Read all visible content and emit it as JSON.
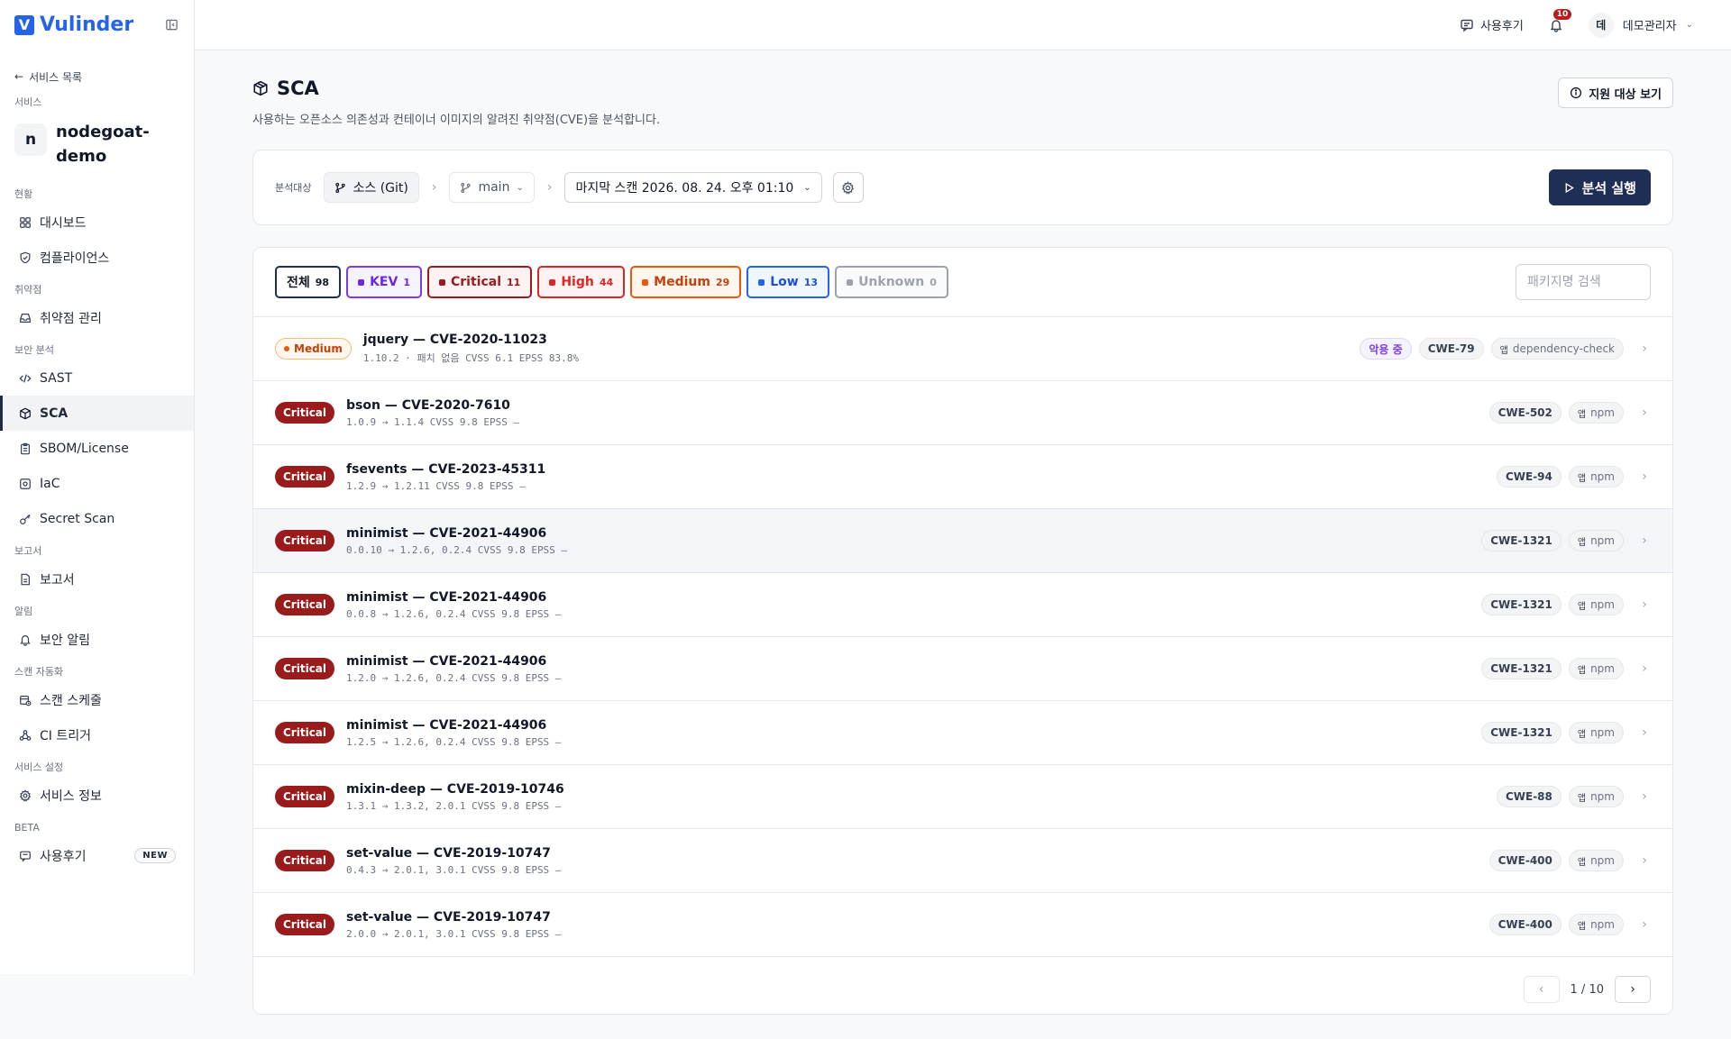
{
  "app": {
    "name": "Vulinder",
    "logo_letter": "V"
  },
  "sidebar": {
    "back_label": "서비스 목록",
    "service_section": "서비스",
    "service_letter": "n",
    "service_name": "nodegoat-demo",
    "groups": [
      {
        "label": "현황",
        "items": [
          {
            "label": "대시보드",
            "icon": "dashboard-icon"
          },
          {
            "label": "컴플라이언스",
            "icon": "shield-icon"
          }
        ]
      },
      {
        "label": "취약점",
        "items": [
          {
            "label": "취약점 관리",
            "icon": "inbox-icon"
          }
        ]
      },
      {
        "label": "보안 분석",
        "items": [
          {
            "label": "SAST",
            "icon": "code-icon"
          },
          {
            "label": "SCA",
            "icon": "package-icon",
            "active": true
          },
          {
            "label": "SBOM/License",
            "icon": "clipboard-icon"
          },
          {
            "label": "IaC",
            "icon": "iac-icon"
          },
          {
            "label": "Secret Scan",
            "icon": "key-icon"
          }
        ]
      },
      {
        "label": "보고서",
        "items": [
          {
            "label": "보고서",
            "icon": "report-icon"
          }
        ]
      },
      {
        "label": "알림",
        "items": [
          {
            "label": "보안 알림",
            "icon": "bell-icon"
          }
        ]
      },
      {
        "label": "스캔 자동화",
        "items": [
          {
            "label": "스캔 스케줄",
            "icon": "calendar-clock-icon"
          },
          {
            "label": "CI 트리거",
            "icon": "webhook-icon"
          }
        ]
      },
      {
        "label": "서비스 설정",
        "items": [
          {
            "label": "서비스 정보",
            "icon": "gear-icon"
          }
        ]
      },
      {
        "label": "BETA",
        "items": [
          {
            "label": "사용후기",
            "icon": "feedback-icon",
            "badge": "NEW"
          }
        ]
      }
    ]
  },
  "header": {
    "feedback_label": "사용후기",
    "notification_count": "10",
    "user_initial": "데",
    "user_name": "데모관리자"
  },
  "page": {
    "title": "SCA",
    "subtitle": "사용하는 오픈소스 의존성과 컨테이너 이미지의 알려진 취약점(CVE)을 분석합니다.",
    "support_button": "지원 대상 보기"
  },
  "target": {
    "label": "분석대상",
    "source": "소스 (Git)",
    "branch": "main",
    "scan": "마지막 스캔 2026. 08. 24. 오후 01:10",
    "run_button": "분석 실행"
  },
  "filters": [
    {
      "label": "전체",
      "count": "98",
      "cls": "f-all",
      "dot": false
    },
    {
      "label": "KEV",
      "count": "1",
      "cls": "f-kev",
      "dot": true
    },
    {
      "label": "Critical",
      "count": "11",
      "cls": "f-crit",
      "dot": true
    },
    {
      "label": "High",
      "count": "44",
      "cls": "f-high",
      "dot": true
    },
    {
      "label": "Medium",
      "count": "29",
      "cls": "f-med",
      "dot": true
    },
    {
      "label": "Low",
      "count": "13",
      "cls": "f-low",
      "dot": true
    },
    {
      "label": "Unknown",
      "count": "0",
      "cls": "f-unk",
      "dot": true
    }
  ],
  "search": {
    "placeholder": "패키지명 검색"
  },
  "rows": [
    {
      "severity": "Medium",
      "title": "jquery — CVE-2020-11023",
      "meta": "1.10.2 · 패치 없음  CVSS 6.1  EPSS 83.8%",
      "exploit": "악용 중",
      "cwe": "CWE-79",
      "kind": "앱",
      "source": "dependency-check"
    },
    {
      "severity": "Critical",
      "title": "bson — CVE-2020-7610",
      "meta": "1.0.9 → 1.1.4  CVSS 9.8  EPSS —",
      "cwe": "CWE-502",
      "kind": "앱",
      "source": "npm"
    },
    {
      "severity": "Critical",
      "title": "fsevents — CVE-2023-45311",
      "meta": "1.2.9 → 1.2.11  CVSS 9.8  EPSS —",
      "cwe": "CWE-94",
      "kind": "앱",
      "source": "npm"
    },
    {
      "severity": "Critical",
      "title": "minimist — CVE-2021-44906",
      "meta": "0.0.10 → 1.2.6, 0.2.4  CVSS 9.8  EPSS —",
      "cwe": "CWE-1321",
      "kind": "앱",
      "source": "npm",
      "hover": true
    },
    {
      "severity": "Critical",
      "title": "minimist — CVE-2021-44906",
      "meta": "0.0.8 → 1.2.6, 0.2.4  CVSS 9.8  EPSS —",
      "cwe": "CWE-1321",
      "kind": "앱",
      "source": "npm"
    },
    {
      "severity": "Critical",
      "title": "minimist — CVE-2021-44906",
      "meta": "1.2.0 → 1.2.6, 0.2.4  CVSS 9.8  EPSS —",
      "cwe": "CWE-1321",
      "kind": "앱",
      "source": "npm"
    },
    {
      "severity": "Critical",
      "title": "minimist — CVE-2021-44906",
      "meta": "1.2.5 → 1.2.6, 0.2.4  CVSS 9.8  EPSS —",
      "cwe": "CWE-1321",
      "kind": "앱",
      "source": "npm"
    },
    {
      "severity": "Critical",
      "title": "mixin-deep — CVE-2019-10746",
      "meta": "1.3.1 → 1.3.2, 2.0.1  CVSS 9.8  EPSS —",
      "cwe": "CWE-88",
      "kind": "앱",
      "source": "npm"
    },
    {
      "severity": "Critical",
      "title": "set-value — CVE-2019-10747",
      "meta": "0.4.3 → 2.0.1, 3.0.1  CVSS 9.8  EPSS —",
      "cwe": "CWE-400",
      "kind": "앱",
      "source": "npm"
    },
    {
      "severity": "Critical",
      "title": "set-value — CVE-2019-10747",
      "meta": "2.0.0 → 2.0.1, 3.0.1  CVSS 9.8  EPSS —",
      "cwe": "CWE-400",
      "kind": "앱",
      "source": "npm"
    }
  ],
  "pagination": {
    "info": "1 / 10"
  }
}
